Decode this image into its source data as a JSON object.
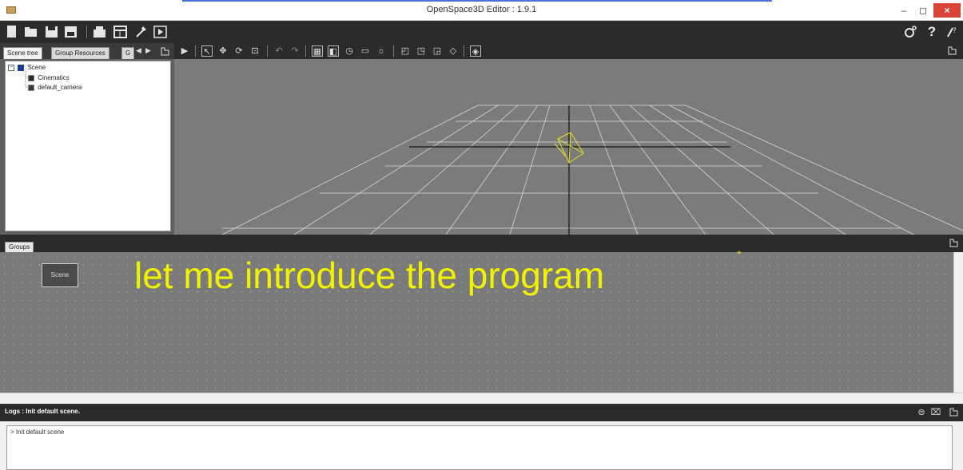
{
  "window": {
    "title": "OpenSpace3D Editor : 1.9.1",
    "minimize": "–",
    "maximize": "◻",
    "close": "×"
  },
  "toolbar": {
    "left_icons": [
      "new-file-icon",
      "open-folder-icon",
      "save-icon",
      "save-as-icon",
      "import-icon",
      "calendar-icon",
      "wizard-icon",
      "play-icon"
    ],
    "right_icons": [
      "settings-icon",
      "help-icon",
      "about-icon"
    ],
    "help_glyph": "?"
  },
  "left_panel": {
    "tabs": [
      "Scene tree",
      "Group Resources",
      "G"
    ],
    "tree": {
      "root": "Scene",
      "children": [
        "Cinematics",
        "default_camera"
      ]
    }
  },
  "groups": {
    "tab_label": "Groups",
    "node_label": "Scene"
  },
  "overlay": {
    "caption": "let me introduce the program"
  },
  "logs": {
    "header": "Logs : Init default scene.",
    "content": "> Init default scene"
  },
  "colors": {
    "dark_bar": "#2b2b2b",
    "viewport_bg": "#7b7b7b",
    "caption": "#f2f200",
    "close_button": "#d9443a"
  }
}
